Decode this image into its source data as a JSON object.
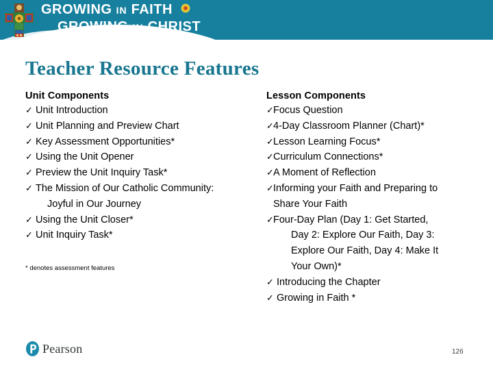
{
  "header": {
    "brand_line_1_main": "GROWING",
    "brand_line_1_in": "IN",
    "brand_line_1_end": "FAITH",
    "brand_line_2_main": "GROWING",
    "brand_line_2_in": "IN",
    "brand_line_2_end": "CHRIST",
    "background_color": "#17809f",
    "cross_icon": "decorated-cross-icon",
    "sun_icon": "sunflower-icon"
  },
  "title": "Teacher Resource Features",
  "title_color": "#18768f",
  "left_column": {
    "heading": "Unit Components",
    "items": [
      {
        "text": "Unit Introduction",
        "check": "✓",
        "cont": false
      },
      {
        "text": "Unit Planning and Preview Chart",
        "check": "✓",
        "cont": false
      },
      {
        "text": "Key Assessment Opportunities*",
        "check": "✓",
        "cont": false
      },
      {
        "text": "Using the Unit Opener",
        "check": "✓",
        "cont": false
      },
      {
        "text": "Preview the Unit Inquiry Task*",
        "check": "✓",
        "cont": false
      },
      {
        "text": "The Mission of Our Catholic Community:",
        "check": "✓",
        "cont": false
      },
      {
        "text": "Joyful in Our Journey",
        "check": "",
        "cont": true
      },
      {
        "text": "Using the Unit Closer*",
        "check": "✓",
        "cont": false
      },
      {
        "text": "Unit Inquiry Task*",
        "check": "✓",
        "cont": false
      }
    ],
    "footnote": "* denotes assessment features"
  },
  "right_column": {
    "heading": "Lesson Components",
    "items": [
      {
        "text": "Focus Question",
        "check": "✓",
        "cont": false
      },
      {
        "text": "4-Day Classroom Planner (Chart)*",
        "check": "✓",
        "cont": false
      },
      {
        "text": "Lesson Learning Focus*",
        "check": "✓",
        "cont": false
      },
      {
        "text": "Curriculum Connections*",
        "check": "✓",
        "cont": false
      },
      {
        "text": "A Moment of Reflection",
        "check": "✓",
        "cont": false
      },
      {
        "text": "Informing your Faith and Preparing to",
        "check": "✓",
        "cont": false
      },
      {
        "text": "Share Your Faith",
        "check": "",
        "cont": true
      },
      {
        "text": "Four-Day Plan (Day 1: Get Started,",
        "check": "✓",
        "cont": false
      },
      {
        "text": "Day 2: Explore Our Faith, Day 3:",
        "check": "",
        "cont": true
      },
      {
        "text": "Explore Our Faith, Day 4: Make It",
        "check": "",
        "cont": true
      },
      {
        "text": "Your Own)*",
        "check": "",
        "cont": true
      },
      {
        "text": "Introducing the Chapter",
        "check": "✓",
        "cont": false
      },
      {
        "text": "Growing in Faith *",
        "check": "✓",
        "cont": false
      }
    ]
  },
  "footer": {
    "logo_word": "Pearson",
    "logo_letter": "P",
    "logo_color": "#1b8aab",
    "page_number": "126"
  }
}
